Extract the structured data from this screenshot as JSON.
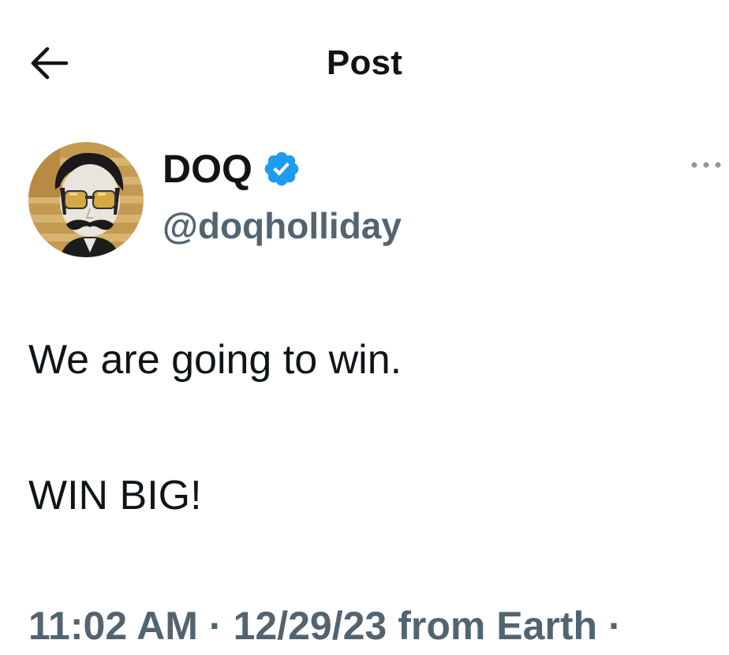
{
  "header": {
    "title": "Post",
    "back_icon": "arrow-left-icon"
  },
  "author": {
    "display_name": "DOQ",
    "handle": "@doqholliday",
    "verified": true,
    "verified_color": "#1d9bf0",
    "avatar_icon": "profile-avatar"
  },
  "post": {
    "line1": "We are going to win.",
    "line2": "WIN BIG!"
  },
  "meta": {
    "time": "11:02 AM",
    "separator": "·",
    "date": "12/29/23",
    "source": "from Earth",
    "trailing": "·"
  },
  "colors": {
    "text_primary": "#0f1419",
    "text_secondary": "#536471",
    "accent": "#1d9bf0"
  }
}
